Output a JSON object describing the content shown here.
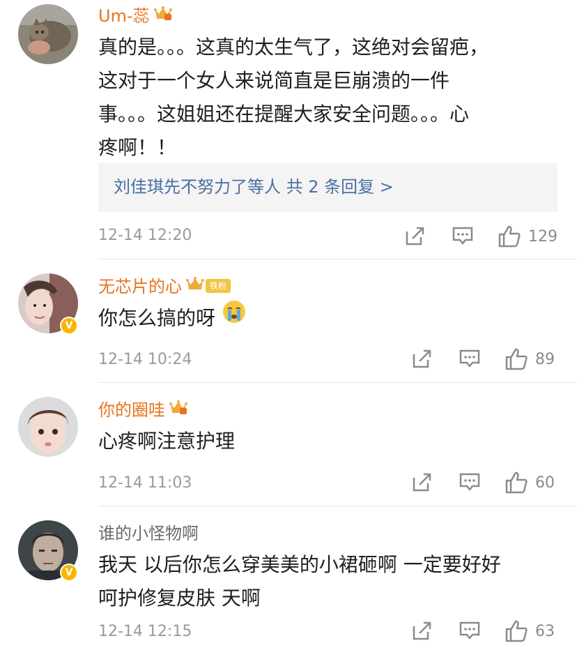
{
  "comments": [
    {
      "username": "Um-蕊",
      "text_lines": [
        "真的是。。。这真的太生气了，这绝对会留疤，",
        "这对于一个女人来说简直是巨崩溃的一件",
        "事。。。这姐姐还在提醒大家安全问题。。。心",
        "疼啊！！"
      ],
      "reply_summary": "刘佳琪先不努力了等人  共 2 条回复 >",
      "timestamp": "12-14 12:20",
      "like_count": "129",
      "badge": "crown-icon"
    },
    {
      "username": "无芯片的心",
      "fan_badge": "铁粉",
      "text": "你怎么搞的呀",
      "emoji": "crying-emoji",
      "timestamp": "12-14 10:24",
      "like_count": "89",
      "badge": "crown-icon"
    },
    {
      "username": "你的圈哇",
      "text": "心疼啊注意护理",
      "timestamp": "12-14 11:03",
      "like_count": "60",
      "badge": "crown-icon"
    },
    {
      "username": "谁的小怪物啊",
      "text_lines": [
        "我天 以后你怎么穿美美的小裙砸啊  一定要好好",
        "呵护修复皮肤 天啊"
      ],
      "timestamp": "12-14 12:15",
      "like_count": "63"
    }
  ],
  "icons": {
    "share": "share-icon",
    "comment": "comment-icon",
    "like": "thumbs-up-icon",
    "verified": "verified-v-icon"
  },
  "colors": {
    "username_vip": "#e8741e",
    "username_normal": "#6b6b6b",
    "reply_link": "#4a6fa5",
    "meta": "#9a9a9a"
  }
}
